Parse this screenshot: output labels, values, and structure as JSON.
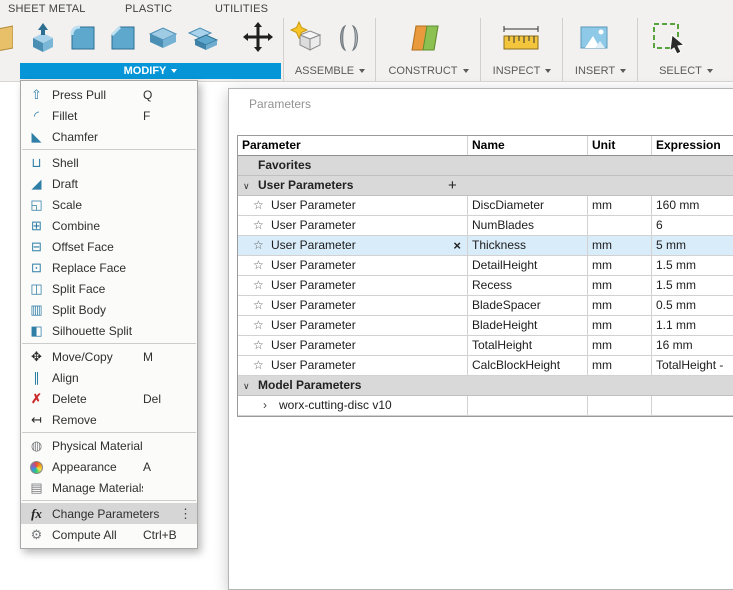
{
  "colors": {
    "accent_blue": "#0696d7",
    "selected_row": "#d9ecf9",
    "group_row": "#d9d9d9",
    "menu_highlight": "#d6d6d6"
  },
  "icons": {
    "star": "☆",
    "plus": "+",
    "close": "×",
    "chevron_down": "∨",
    "chevron_right": "›",
    "dots": "⋮"
  },
  "ribbon": {
    "tabs": [
      {
        "label": "SHEET METAL"
      },
      {
        "label": "PLASTIC"
      },
      {
        "label": "UTILITIES"
      }
    ],
    "groups": {
      "modify": "MODIFY",
      "assemble": "ASSEMBLE",
      "construct": "CONSTRUCT",
      "inspect": "INSPECT",
      "insert": "INSERT",
      "select": "SELECT"
    }
  },
  "modify_menu": {
    "items": [
      {
        "label": "Press Pull",
        "shortcut": "Q",
        "glyph": "⇧"
      },
      {
        "label": "Fillet",
        "shortcut": "F",
        "glyph": "◜"
      },
      {
        "label": "Chamfer",
        "glyph": "◣"
      },
      {
        "label": "Shell",
        "glyph": "⊔"
      },
      {
        "label": "Draft",
        "glyph": "◢"
      },
      {
        "label": "Scale",
        "glyph": "◱"
      },
      {
        "label": "Combine",
        "glyph": "⊞"
      },
      {
        "label": "Offset Face",
        "glyph": "⊟"
      },
      {
        "label": "Replace Face",
        "glyph": "⊡"
      },
      {
        "label": "Split Face",
        "glyph": "◫"
      },
      {
        "label": "Split Body",
        "glyph": "▥"
      },
      {
        "label": "Silhouette Split",
        "glyph": "◧"
      },
      {
        "label": "Move/Copy",
        "shortcut": "M",
        "glyph": "✥"
      },
      {
        "label": "Align",
        "glyph": "∥"
      },
      {
        "label": "Delete",
        "shortcut": "Del",
        "glyph": "✗"
      },
      {
        "label": "Remove",
        "glyph": "↤"
      },
      {
        "label": "Physical Material",
        "glyph": "◍"
      },
      {
        "label": "Appearance",
        "shortcut": "A"
      },
      {
        "label": "Manage Materials",
        "glyph": "▤"
      },
      {
        "label": "Change Parameters",
        "glyph": "fx"
      },
      {
        "label": "Compute All",
        "shortcut": "Ctrl+B",
        "glyph": "⚙"
      }
    ]
  },
  "parameters_dialog": {
    "title": "Parameters",
    "columns": [
      "Parameter",
      "Name",
      "Unit",
      "Expression"
    ],
    "favorites_label": "Favorites",
    "user_parameters_label": "User Parameters",
    "model_parameters_label": "Model Parameters",
    "model_row_label": "worx-cutting-disc v10",
    "row_label": "User Parameter",
    "rows": [
      {
        "name": "DiscDiameter",
        "unit": "mm",
        "expression": "160 mm"
      },
      {
        "name": "NumBlades",
        "unit": "",
        "expression": "6"
      },
      {
        "name": "Thickness",
        "unit": "mm",
        "expression": "5 mm",
        "selected": true
      },
      {
        "name": "DetailHeight",
        "unit": "mm",
        "expression": "1.5 mm"
      },
      {
        "name": "Recess",
        "unit": "mm",
        "expression": "1.5 mm"
      },
      {
        "name": "BladeSpacer",
        "unit": "mm",
        "expression": "0.5 mm"
      },
      {
        "name": "BladeHeight",
        "unit": "mm",
        "expression": "1.1 mm"
      },
      {
        "name": "TotalHeight",
        "unit": "mm",
        "expression": "16 mm"
      },
      {
        "name": "CalcBlockHeight",
        "unit": "mm",
        "expression": "TotalHeight -"
      }
    ]
  }
}
